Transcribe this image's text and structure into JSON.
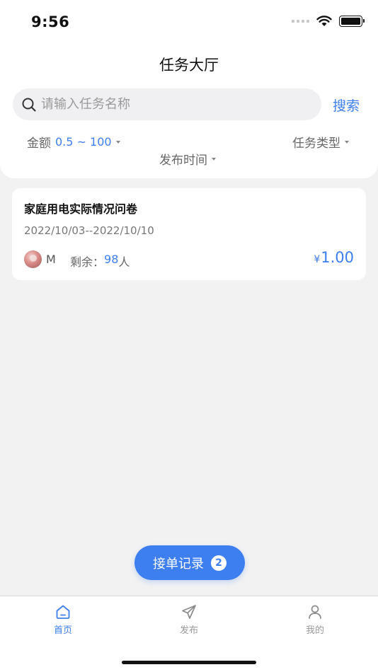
{
  "status_bar": {
    "time": "9:56"
  },
  "header": {
    "title": "任务大厅"
  },
  "search": {
    "placeholder": "请输入任务名称",
    "value": "",
    "button_label": "搜索"
  },
  "filters": {
    "amount_label": "金额",
    "amount_value": "0.5 ~ 100",
    "type_label": "任务类型",
    "time_label": "发布时间"
  },
  "tasks": [
    {
      "title": "家庭用电实际情况问卷",
      "dates": "2022/10/03--2022/10/10",
      "publisher": "M",
      "remaining_label": "剩余：",
      "remaining_count": "98",
      "remaining_unit": "人",
      "currency": "¥",
      "price": "1.00"
    }
  ],
  "orders_button": {
    "label": "接单记录",
    "badge": "2"
  },
  "tab_bar": {
    "items": [
      {
        "label": "首页",
        "icon": "home-icon",
        "active": true
      },
      {
        "label": "发布",
        "icon": "send-icon",
        "active": false
      },
      {
        "label": "我的",
        "icon": "user-icon",
        "active": false
      }
    ]
  },
  "colors": {
    "accent": "#3d7ef0",
    "background": "#f2f2f3"
  }
}
